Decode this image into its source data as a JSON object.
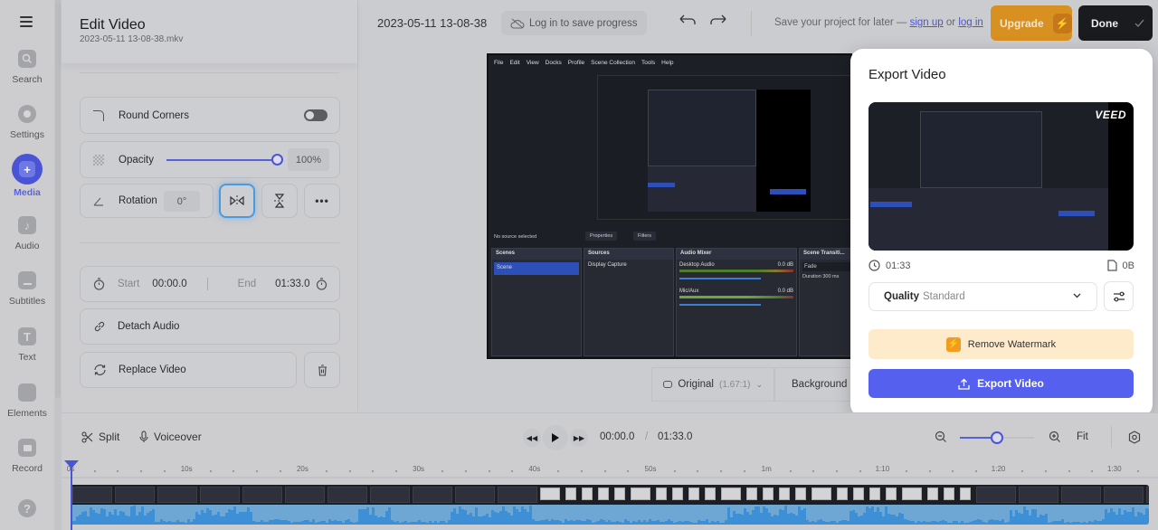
{
  "nav": {
    "items": [
      {
        "label": "Search",
        "icon": "search-icon"
      },
      {
        "label": "Settings",
        "icon": "gear-icon"
      },
      {
        "label": "Media",
        "icon": "plus-icon",
        "active": true
      },
      {
        "label": "Audio",
        "icon": "music-note-icon"
      },
      {
        "label": "Subtitles",
        "icon": "subtitles-icon"
      },
      {
        "label": "Text",
        "icon": "text-icon"
      },
      {
        "label": "Elements",
        "icon": "elements-icon"
      },
      {
        "label": "Record",
        "icon": "camera-icon"
      }
    ],
    "help": "?"
  },
  "panel": {
    "title": "Edit Video",
    "filename": "2023-05-11 13-08-38.mkv",
    "round_corners": {
      "label": "Round Corners",
      "enabled": false
    },
    "opacity": {
      "label": "Opacity",
      "value": "100%",
      "fraction": 1.0
    },
    "rotation": {
      "label": "Rotation",
      "value": "0°"
    },
    "trim": {
      "start_label": "Start",
      "start": "00:00.0",
      "end_label": "End",
      "end": "01:33.0"
    },
    "detach_audio": "Detach Audio",
    "replace_video": "Replace Video"
  },
  "topbar": {
    "project_name": "2023-05-11 13-08-38",
    "login_pill": "Log in to save progress",
    "save_text": "Save your project for later —",
    "sign_up": "sign up",
    "or": "or",
    "log_in": "log in",
    "upgrade": "Upgrade",
    "done": "Done"
  },
  "preview": {
    "obs_menu": [
      "File",
      "Edit",
      "View",
      "Docks",
      "Profile",
      "Scene Collection",
      "Tools",
      "Help"
    ],
    "no_source": "No source selected",
    "properties": "Properties",
    "filters": "Filters",
    "docks": {
      "scenes": "Scenes",
      "scene_item": "Scene",
      "sources": "Sources",
      "source_item": "Display Capture",
      "audio_mixer": "Audio Mixer",
      "desktop_audio": "Desktop Audio",
      "mic_aux": "Mic/Aux",
      "db": "0.0 dB",
      "transitions": "Scene Transiti...",
      "fade": "Fade",
      "duration_label": "Duration",
      "duration": "300 ms"
    },
    "aspect_label": "Original",
    "aspect_ratio": "(1.67:1)",
    "background_label": "Background"
  },
  "export": {
    "title": "Export Video",
    "watermark": "VEED",
    "duration": "01:33",
    "size": "0B",
    "quality_label": "Quality",
    "quality_value": "Standard",
    "remove_watermark": "Remove Watermark",
    "export_button": "Export Video"
  },
  "timeline": {
    "split": "Split",
    "voiceover": "Voiceover",
    "current_time": "00:00.0",
    "separator": "/",
    "total_time": "01:33.0",
    "fit": "Fit",
    "zoom_fraction": 0.5,
    "ticks": [
      "0s",
      "10s",
      "20s",
      "30s",
      "40s",
      "50s",
      "1m",
      "1:10",
      "1:20",
      "1:30"
    ]
  },
  "colors": {
    "accent": "#4a55d6",
    "upgrade": "#d89020",
    "export": "#5561ee",
    "watermark_bg": "#fdebcc"
  }
}
